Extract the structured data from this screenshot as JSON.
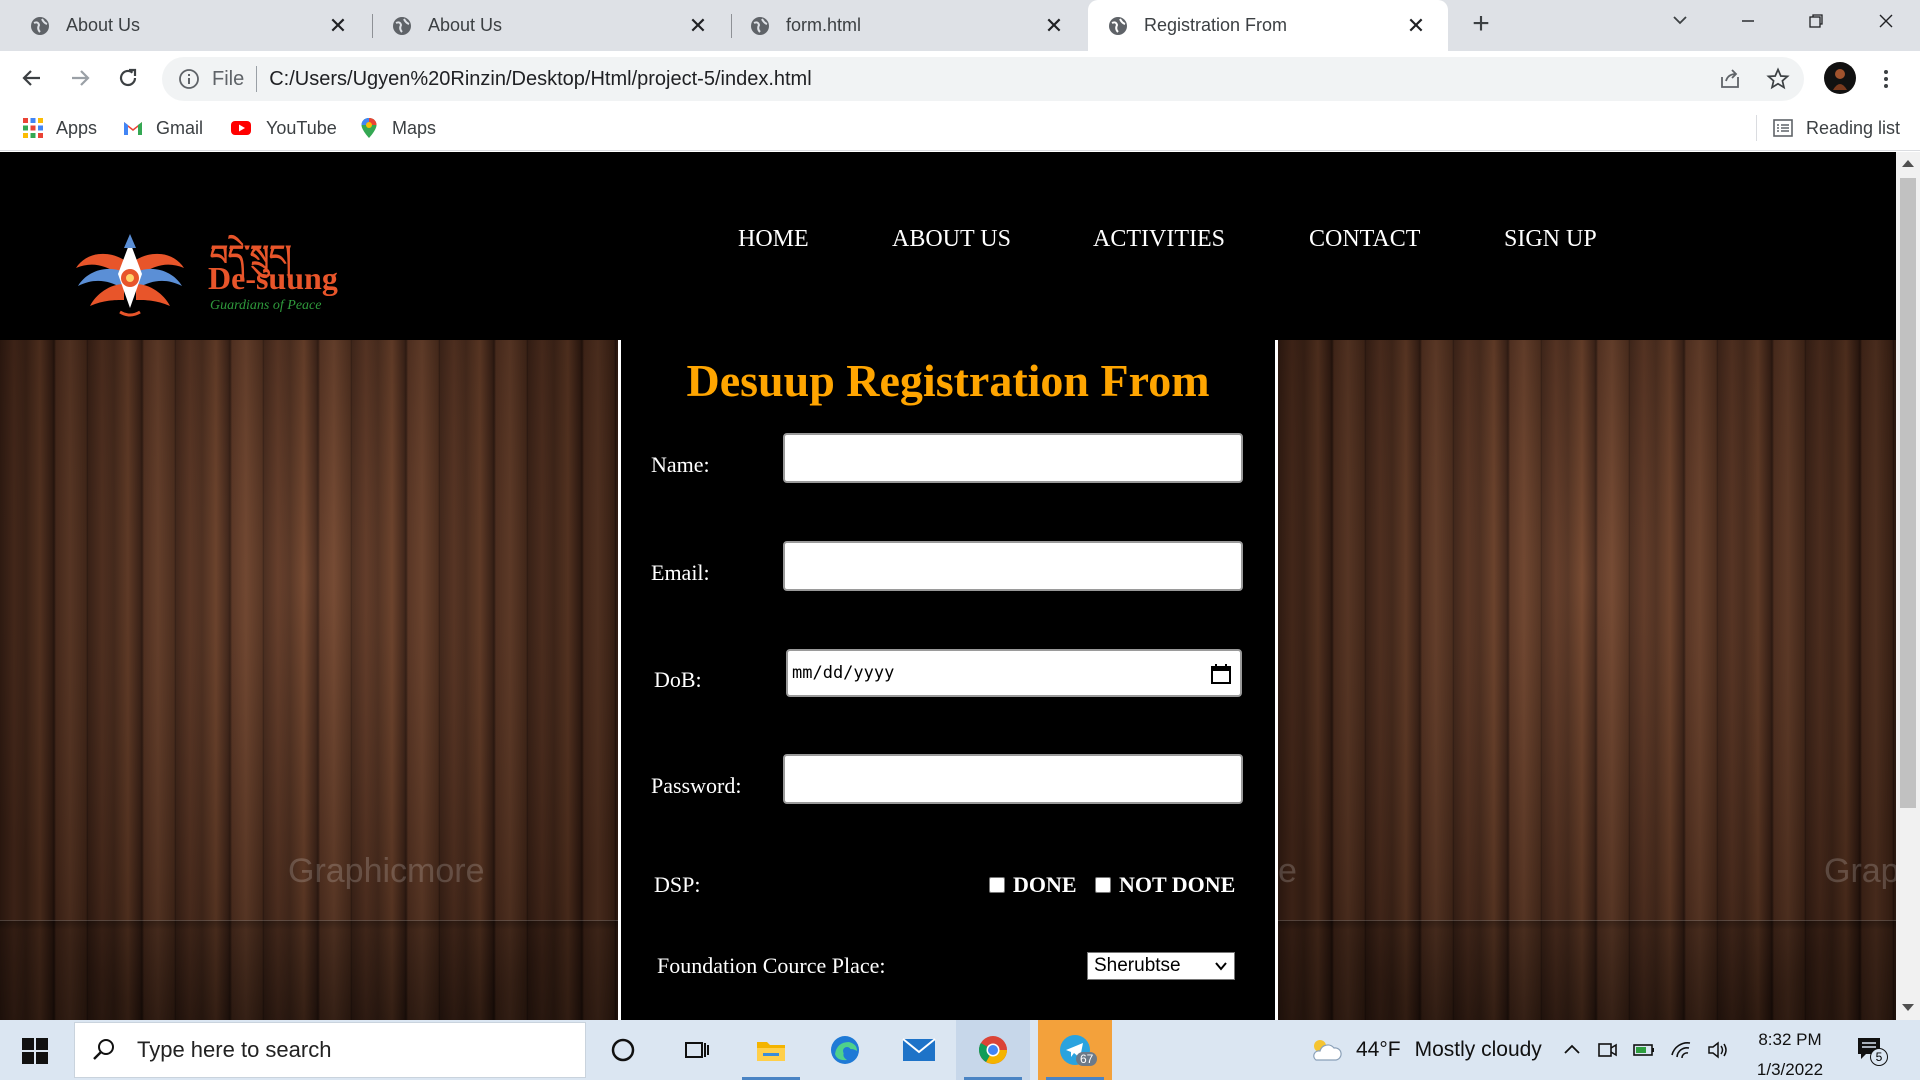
{
  "browser": {
    "tabs": [
      {
        "title": "About Us",
        "active": false
      },
      {
        "title": "About Us",
        "active": false
      },
      {
        "title": "form.html",
        "active": false
      },
      {
        "title": "Registration From",
        "active": true
      }
    ],
    "new_tab_label": "+",
    "address": {
      "scheme_label": "File",
      "url": "C:/Users/Ugyen%20Rinzin/Desktop/Html/project-5/index.html"
    },
    "bookmarks": [
      {
        "label": "Apps",
        "icon": "apps-grid-icon"
      },
      {
        "label": "Gmail",
        "icon": "gmail-icon"
      },
      {
        "label": "YouTube",
        "icon": "youtube-icon"
      },
      {
        "label": "Maps",
        "icon": "maps-pin-icon"
      }
    ],
    "reading_list_label": "Reading list"
  },
  "site": {
    "logo": {
      "script_text": "བདེ་སྲུང།",
      "name": "De-suung",
      "tagline": "Guardians of Peace"
    },
    "nav": [
      "HOME",
      "ABOUT US",
      "ACTIVITIES",
      "CONTACT",
      "SIGN UP"
    ],
    "watermark": "Graphicmore",
    "watermark_right": "Grap",
    "form": {
      "title": "Desuup Registration From",
      "labels": {
        "name": "Name:",
        "email": "Email:",
        "dob": "DoB:",
        "password": "Password:",
        "dsp": "DSP:",
        "foundation": "Foundation Cource Place:"
      },
      "values": {
        "name": "",
        "email": "",
        "password": ""
      },
      "dob_placeholder": "mm/dd/yyyy",
      "dsp_options": [
        "DONE",
        "NOT DONE"
      ],
      "foundation_selected": "Sherubtse"
    }
  },
  "taskbar": {
    "search_placeholder": "Type here to search",
    "weather": {
      "temp": "44°F",
      "condition": "Mostly cloudy"
    },
    "clock": {
      "time": "8:32 PM",
      "date": "1/3/2022"
    },
    "telegram_badge": "67",
    "notifications_count": "5"
  },
  "colors": {
    "title_orange": "#ffa500",
    "header_bg": "#000000",
    "logo_orange": "#e8552a",
    "logo_green": "#2f9a3c"
  }
}
